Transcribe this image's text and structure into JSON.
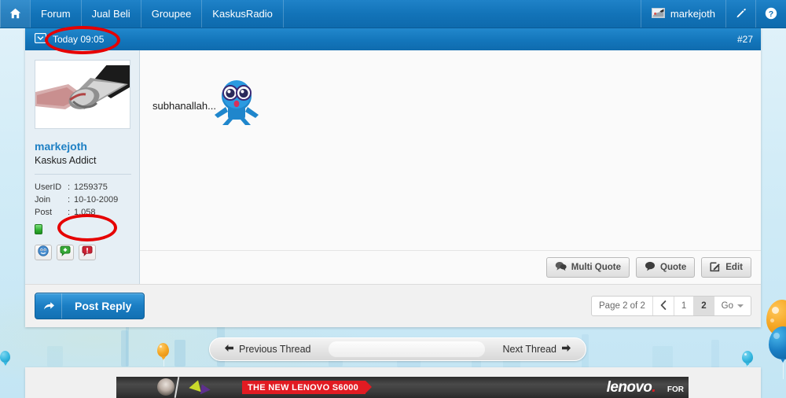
{
  "topnav": {
    "home_icon": "home-icon",
    "items": [
      {
        "label": "Forum"
      },
      {
        "label": "Jual Beli"
      },
      {
        "label": "Groupee"
      },
      {
        "label": "KaskusRadio"
      }
    ],
    "user": {
      "name": "markejoth",
      "avatar_icon": "user-avatar-icon"
    },
    "edit_icon": "pencil-icon",
    "help_icon": "help-circle-icon"
  },
  "post": {
    "header": {
      "message_icon": "envelope-icon",
      "timestamp": "Today 09:05",
      "number": "#27"
    },
    "author": {
      "avatar_icon": "handshake-avatar",
      "username": "markejoth",
      "title": "Kaskus Addict",
      "meta": [
        {
          "key": "UserID",
          "sep": ":",
          "value": "1259375"
        },
        {
          "key": "Join",
          "sep": ":",
          "value": "10-10-2009"
        },
        {
          "key": "Post",
          "sep": ":",
          "value": "1,058"
        }
      ],
      "online_status": "online",
      "actions": [
        {
          "name": "profile-smiley-icon"
        },
        {
          "name": "add-reputation-icon"
        },
        {
          "name": "report-post-icon"
        }
      ]
    },
    "content": {
      "text": "subhanallah...",
      "smiley": "shocked-blue-smiley"
    },
    "actions": [
      {
        "label": "Multi Quote",
        "icon": "multi-quote-icon"
      },
      {
        "label": "Quote",
        "icon": "quote-icon"
      },
      {
        "label": "Edit",
        "icon": "edit-icon"
      }
    ]
  },
  "footer": {
    "post_reply": {
      "label": "Post Reply",
      "icon": "reply-arrow-icon"
    },
    "pagination": {
      "summary": "Page 2 of 2",
      "prev_icon": "chevron-left-icon",
      "pages": [
        {
          "label": "1",
          "active": false
        },
        {
          "label": "2",
          "active": true
        }
      ],
      "go_label": "Go"
    }
  },
  "thread_nav": {
    "previous": "Previous Thread",
    "previous_icon": "arrow-left-icon",
    "next": "Next Thread",
    "next_icon": "arrow-right-icon"
  },
  "ad": {
    "tagline": "THE NEW LENOVO S6000",
    "brand": "lenovo",
    "brand_suffix": "FOR"
  },
  "colors": {
    "nav_blue": "#1273b8",
    "post_header_blue": "#1376bb",
    "link_blue": "#1f80c4",
    "annotation_red": "#e60000",
    "reply_blue": "#1b7ec4",
    "ad_red": "#e11b22",
    "page_bg": "#c3e5f4"
  },
  "annotations": [
    {
      "name": "timestamp-highlight",
      "target": "Today 09:05"
    },
    {
      "name": "post-count-highlight",
      "target": "1,058"
    }
  ]
}
